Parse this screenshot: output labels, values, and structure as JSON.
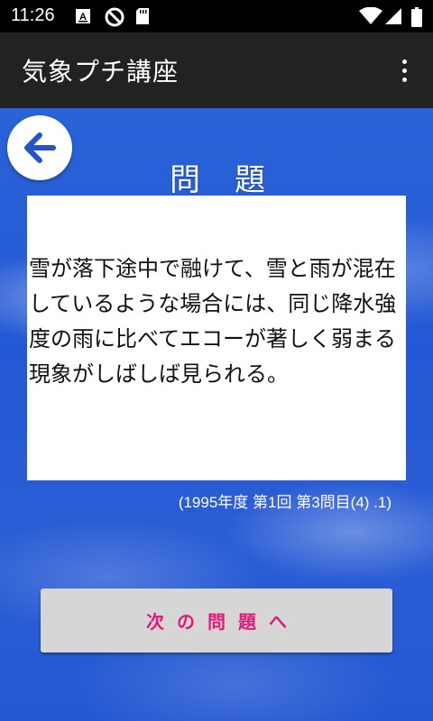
{
  "status_bar": {
    "time": "11:26",
    "icons": [
      "text-a-icon",
      "no-sim-icon",
      "sd-card-icon",
      "wifi-icon",
      "signal-icon",
      "battery-icon"
    ]
  },
  "app_bar": {
    "title": "気象プチ講座",
    "menu_icon": "overflow-menu-icon"
  },
  "main": {
    "back_icon": "arrow-left-icon",
    "heading": "問　題",
    "question": "雪が落下途中で融けて、雪と雨が混在しているような場合には、同じ降水強度の雨に比べてエコーが著しく弱まる現象がしばしば見られる。",
    "source": "(1995年度 第1回 第3問目(4) .1)",
    "next_label": "次の問題へ"
  },
  "colors": {
    "background_blue": "#2358d4",
    "app_bar": "#222222",
    "back_arrow": "#2255c8",
    "next_label": "#e0197d",
    "next_button": "#d6d6d6"
  }
}
